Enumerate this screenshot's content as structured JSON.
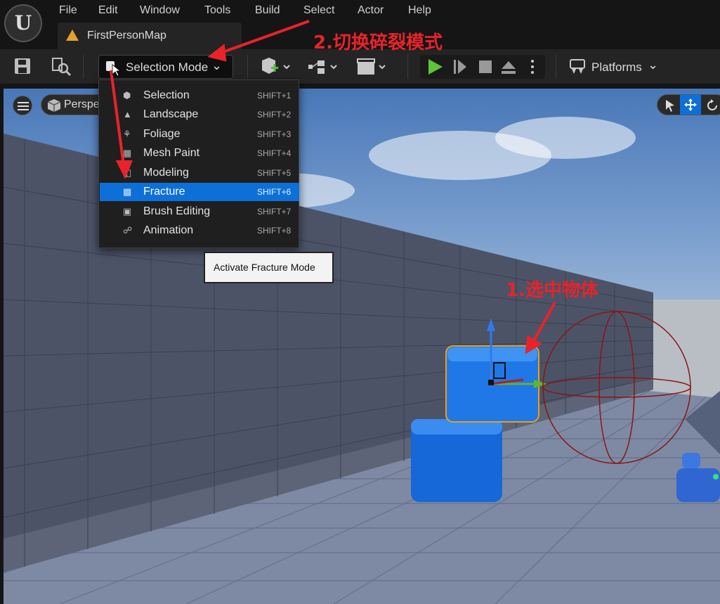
{
  "menubar": {
    "logo": "U",
    "items": [
      "File",
      "Edit",
      "Window",
      "Tools",
      "Build",
      "Select",
      "Actor",
      "Help"
    ]
  },
  "tab": {
    "title": "FirstPersonMap"
  },
  "toolbar": {
    "selection_mode_label": "Selection Mode",
    "platforms_label": "Platforms"
  },
  "viewport": {
    "perspective_label": "Perspe"
  },
  "mode_menu": {
    "items": [
      {
        "label": "Selection",
        "shortcut": "SHIFT+1",
        "icon": "selection-icon"
      },
      {
        "label": "Landscape",
        "shortcut": "SHIFT+2",
        "icon": "landscape-icon"
      },
      {
        "label": "Foliage",
        "shortcut": "SHIFT+3",
        "icon": "foliage-icon"
      },
      {
        "label": "Mesh Paint",
        "shortcut": "SHIFT+4",
        "icon": "mesh-paint-icon"
      },
      {
        "label": "Modeling",
        "shortcut": "SHIFT+5",
        "icon": "modeling-icon"
      },
      {
        "label": "Fracture",
        "shortcut": "SHIFT+6",
        "icon": "fracture-icon"
      },
      {
        "label": "Brush Editing",
        "shortcut": "SHIFT+7",
        "icon": "brush-editing-icon"
      },
      {
        "label": "Animation",
        "shortcut": "SHIFT+8",
        "icon": "animation-icon"
      }
    ],
    "active_index": 5
  },
  "tooltip": {
    "text": "Activate Fracture Mode"
  },
  "annotations": {
    "step1": "1.选中物体",
    "step2": "2.切换碎裂模式"
  },
  "colors": {
    "accent": "#0d70d8",
    "annotation": "#e8232a",
    "play": "#5fc43a"
  }
}
